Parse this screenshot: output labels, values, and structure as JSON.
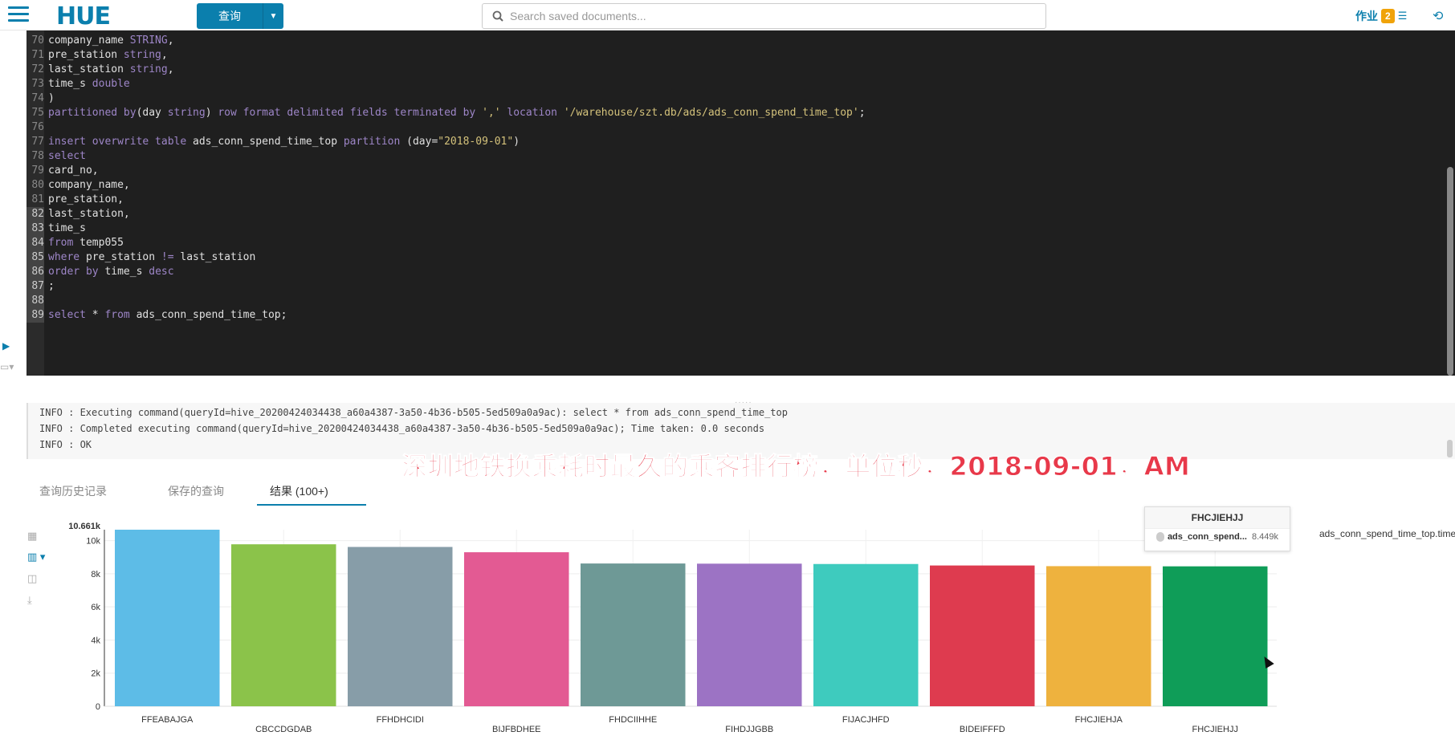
{
  "topbar": {
    "query_label": "查询",
    "search_placeholder": "Search saved documents...",
    "jobs_label": "作业",
    "jobs_count": "2"
  },
  "editor": {
    "lines": [
      {
        "n": "70",
        "tokens": [
          [
            "",
            "company_name "
          ],
          [
            "kw",
            "STRING"
          ],
          [
            "",
            ","
          ]
        ]
      },
      {
        "n": "71",
        "tokens": [
          [
            "",
            "pre_station "
          ],
          [
            "kw",
            "string"
          ],
          [
            "",
            ","
          ]
        ]
      },
      {
        "n": "72",
        "tokens": [
          [
            "",
            "last_station "
          ],
          [
            "kw",
            "string"
          ],
          [
            "",
            ","
          ]
        ]
      },
      {
        "n": "73",
        "tokens": [
          [
            "",
            "time_s "
          ],
          [
            "kw",
            "double"
          ]
        ]
      },
      {
        "n": "74",
        "tokens": [
          [
            "",
            ")"
          ]
        ]
      },
      {
        "n": "75",
        "tokens": [
          [
            "kw",
            "partitioned by"
          ],
          [
            "",
            "(day "
          ],
          [
            "kw",
            "string"
          ],
          [
            "",
            ") "
          ],
          [
            "kw",
            "row format delimited fields terminated by"
          ],
          [
            "",
            " "
          ],
          [
            "str",
            "','"
          ],
          [
            "",
            " "
          ],
          [
            "kw",
            "location"
          ],
          [
            "",
            " "
          ],
          [
            "str",
            "'/warehouse/szt.db/ads/ads_conn_spend_time_top'"
          ],
          [
            "",
            ";"
          ]
        ]
      },
      {
        "n": "76",
        "tokens": [
          [
            "",
            ""
          ]
        ]
      },
      {
        "n": "77",
        "tokens": [
          [
            "kw",
            "insert overwrite table"
          ],
          [
            "",
            " ads_conn_spend_time_top "
          ],
          [
            "kw",
            "partition"
          ],
          [
            "",
            " (day="
          ],
          [
            "str",
            "\"2018-09-01\""
          ],
          [
            "",
            ")"
          ]
        ]
      },
      {
        "n": "78",
        "tokens": [
          [
            "kw",
            "select"
          ]
        ]
      },
      {
        "n": "79",
        "tokens": [
          [
            "",
            "card_no,"
          ]
        ]
      },
      {
        "n": "80",
        "tokens": [
          [
            "",
            "company_name,"
          ]
        ]
      },
      {
        "n": "81",
        "tokens": [
          [
            "",
            "pre_station,"
          ]
        ]
      },
      {
        "n": "82",
        "hl": true,
        "tokens": [
          [
            "",
            "last_station,"
          ]
        ]
      },
      {
        "n": "83",
        "hl": true,
        "tokens": [
          [
            "",
            "time_s"
          ]
        ]
      },
      {
        "n": "84",
        "hl": true,
        "tokens": [
          [
            "kw",
            "from"
          ],
          [
            "",
            " temp055"
          ]
        ]
      },
      {
        "n": "85",
        "hl": true,
        "tokens": [
          [
            "kw",
            "where"
          ],
          [
            "",
            " pre_station "
          ],
          [
            "kw",
            "!="
          ],
          [
            "",
            " last_station"
          ]
        ]
      },
      {
        "n": "86",
        "hl": true,
        "tokens": [
          [
            "kw",
            "order by"
          ],
          [
            "",
            " time_s "
          ],
          [
            "kw",
            "desc"
          ]
        ]
      },
      {
        "n": "87",
        "hl": true,
        "tokens": [
          [
            "",
            ";"
          ]
        ]
      },
      {
        "n": "88",
        "hl": true,
        "tokens": [
          [
            "",
            ""
          ]
        ]
      },
      {
        "n": "89",
        "hl": true,
        "tokens": [
          [
            "kw",
            "select"
          ],
          [
            "",
            " * "
          ],
          [
            "kw",
            "from"
          ],
          [
            "",
            " ads_conn_spend_time_top;"
          ]
        ]
      }
    ]
  },
  "log": {
    "lines": [
      "INFO  : Executing command(queryId=hive_20200424034438_a60a4387-3a50-4b36-b505-5ed509a0a9ac): select * from ads_conn_spend_time_top",
      "INFO  : Completed executing command(queryId=hive_20200424034438_a60a4387-3a50-4b36-b505-5ed509a0a9ac); Time taken: 0.0 seconds",
      "INFO  : OK"
    ]
  },
  "overlay_caption": "深圳地铁换乘耗时最久的乘客排行榜，单位秒，2018-09-01，AM",
  "tabs": [
    "查询历史记录",
    "保存的查询",
    "结果 (100+)"
  ],
  "tooltip": {
    "title": "FHCJIEHJJ",
    "series": "ads_conn_spend...",
    "value": "8.449k"
  },
  "legend": {
    "label": "ads_conn_spend_time_top.time_s"
  },
  "chart_data": {
    "type": "bar",
    "categories": [
      "FFEABAJGA",
      "CBCCDGDAB",
      "FFHDHCIDI",
      "BIJFBDHEE",
      "FHDCIIHHE",
      "FIHDJJGBB",
      "FIJACJHFD",
      "BIDEIFFFD",
      "FHCJIEHJA",
      "FHCJIEHJJ"
    ],
    "values": [
      10661,
      9780,
      9620,
      9300,
      8620,
      8610,
      8590,
      8500,
      8460,
      8449
    ],
    "colors": [
      "#5DBCE7",
      "#8BC34A",
      "#879DA8",
      "#E35A93",
      "#6E9996",
      "#9C73C4",
      "#3ECBBE",
      "#DE3B4F",
      "#EEB23E",
      "#0F9D58"
    ],
    "ylim": [
      0,
      10661
    ],
    "yticks": [
      "0",
      "2k",
      "4k",
      "6k",
      "8k",
      "10k"
    ],
    "ymax_label": "10.661k",
    "legend": "ads_conn_spend_time_top.time_s"
  }
}
